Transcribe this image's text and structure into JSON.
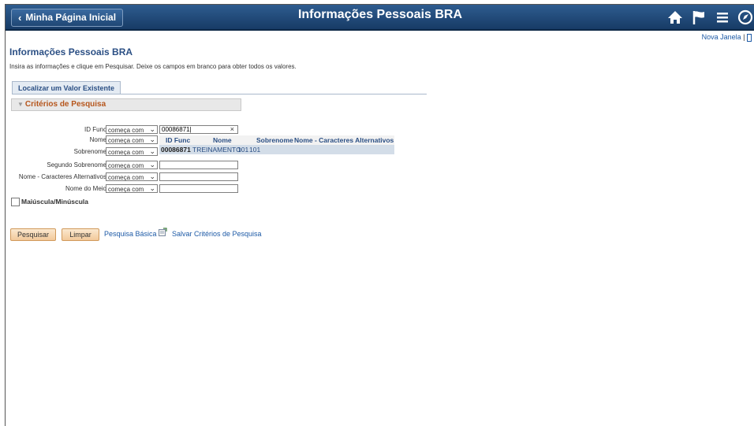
{
  "header": {
    "home_link": "Minha Página Inicial",
    "title": "Informações Pessoais BRA",
    "icons": [
      "home-icon",
      "flag-icon",
      "menu-icon",
      "compass-icon"
    ]
  },
  "top_links": {
    "new_window": "Nova Janela",
    "separator": "|"
  },
  "page": {
    "heading": "Informações Pessoais BRA",
    "instructions": "Insira as informações e clique em Pesquisar. Deixe os campos em branco para obter todos os valores."
  },
  "tabs": {
    "find_existing": "Localizar um Valor Existente"
  },
  "criteria": {
    "title": "Critérios de Pesquisa",
    "rows": [
      {
        "label": "ID Func",
        "operator": "começa com",
        "value": "00086871"
      },
      {
        "label": "Nome",
        "operator": "começa com",
        "value": ""
      },
      {
        "label": "Sobrenome",
        "operator": "começa com",
        "value": ""
      },
      {
        "label": "Segundo Sobrenome",
        "operator": "começa com",
        "value": ""
      },
      {
        "label": "Nome - Caracteres Alternativos",
        "operator": "começa com",
        "value": ""
      },
      {
        "label": "Nome do Meio",
        "operator": "começa com",
        "value": ""
      }
    ],
    "clear_symbol": "×"
  },
  "suggestions": {
    "headers": [
      "ID Func",
      "Nome",
      "Sobrenome",
      "Nome - Caracteres Alternativos"
    ],
    "row": {
      "id": "00086871",
      "name": "TREINAMENTO",
      "surname": "101",
      "alt_name": "101"
    }
  },
  "case_sensitive": {
    "label": "Maiúscula/Minúscula",
    "checked": false
  },
  "actions": {
    "search": "Pesquisar",
    "clear": "Limpar",
    "basic_search": "Pesquisa Básica",
    "save_criteria": "Salvar Critérios de Pesquisa"
  }
}
